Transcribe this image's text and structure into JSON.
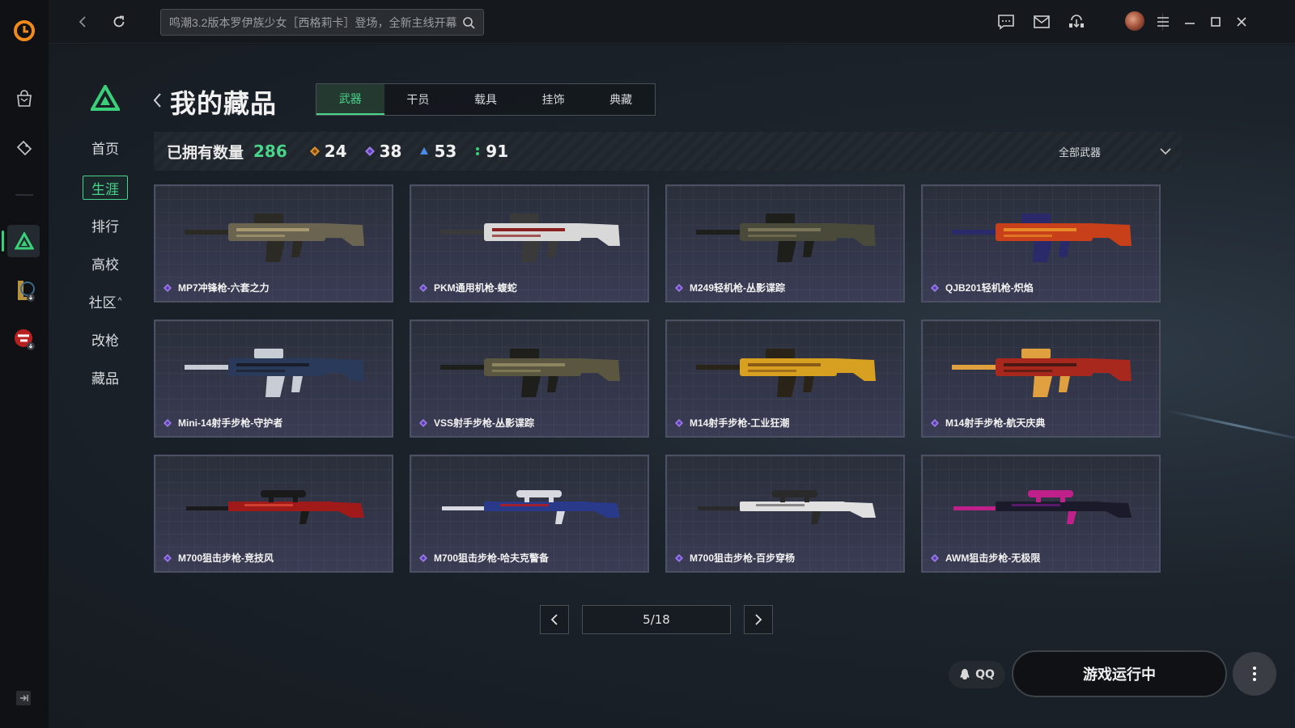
{
  "topbar": {
    "search_placeholder": "鸣潮3.2版本罗伊族少女［西格莉卡］登场，全新主线开幕"
  },
  "sidebar": {
    "items": [
      {
        "label": "首页",
        "active": false
      },
      {
        "label": "生涯",
        "active": true
      },
      {
        "label": "排行",
        "active": false
      },
      {
        "label": "高校",
        "active": false
      },
      {
        "label": "社区",
        "active": false,
        "caret": "^"
      },
      {
        "label": "改枪",
        "active": false
      },
      {
        "label": "藏品",
        "active": false
      }
    ]
  },
  "page": {
    "title": "我的藏品"
  },
  "tabs": [
    {
      "label": "武器",
      "active": true
    },
    {
      "label": "干员",
      "active": false
    },
    {
      "label": "载具",
      "active": false
    },
    {
      "label": "挂饰",
      "active": false
    },
    {
      "label": "典藏",
      "active": false
    }
  ],
  "stats": {
    "label": "已拥有数量",
    "total": "286",
    "tiers": [
      {
        "count": "24",
        "color": "#e0902a"
      },
      {
        "count": "38",
        "color": "#9a7ae8"
      },
      {
        "count": "53",
        "color": "#4a8ae8"
      },
      {
        "count": "91",
        "color": "#3ad07a"
      }
    ]
  },
  "filter": {
    "label": "全部武器"
  },
  "items": [
    {
      "name": "MP7冲锋枪-六套之力",
      "palette": [
        "#6b6450",
        "#2b2a24",
        "#a89a70"
      ]
    },
    {
      "name": "PKM通用机枪-蝮蛇",
      "palette": [
        "#d8d8d8",
        "#3a3a3a",
        "#8a2020"
      ]
    },
    {
      "name": "M249轻机枪-丛影谍踪",
      "palette": [
        "#4a4a3a",
        "#1e1e1a",
        "#7a7458"
      ]
    },
    {
      "name": "QJB201轻机枪-炽焰",
      "palette": [
        "#c8401a",
        "#2a2a6a",
        "#e88a2a"
      ]
    },
    {
      "name": "Mini-14射手步枪-守护者",
      "palette": [
        "#2a3a5a",
        "#c8ccd4",
        "#1a1e2a"
      ]
    },
    {
      "name": "VSS射手步枪-丛影谍踪",
      "palette": [
        "#5a5640",
        "#1e1e1a",
        "#8a8460"
      ]
    },
    {
      "name": "M14射手步枪-工业狂潮",
      "palette": [
        "#d8a020",
        "#2a2418",
        "#8a5a18"
      ]
    },
    {
      "name": "M14射手步枪-航天庆典",
      "palette": [
        "#a8281e",
        "#e0a040",
        "#4a1812"
      ]
    },
    {
      "name": "M700狙击步枪-竞技风",
      "palette": [
        "#a01a1a",
        "#1a1a1a",
        "#d04030"
      ]
    },
    {
      "name": "M700狙击步枪-哈夫克警备",
      "palette": [
        "#2a3a8a",
        "#d8d8e0",
        "#a02030"
      ]
    },
    {
      "name": "M700狙击步枪-百步穿杨",
      "palette": [
        "#e0e0e0",
        "#2a2a2a",
        "#8a8a8a"
      ]
    },
    {
      "name": "AWM狙击步枪-无极限",
      "palette": [
        "#1a1a2a",
        "#c0208a",
        "#5a1a6a"
      ]
    }
  ],
  "pager": {
    "text": "5/18"
  },
  "bottom": {
    "qq": "QQ",
    "run": "游戏运行中"
  },
  "colors": {
    "accent": "#49d48a",
    "gem": "#9a7ae8"
  }
}
